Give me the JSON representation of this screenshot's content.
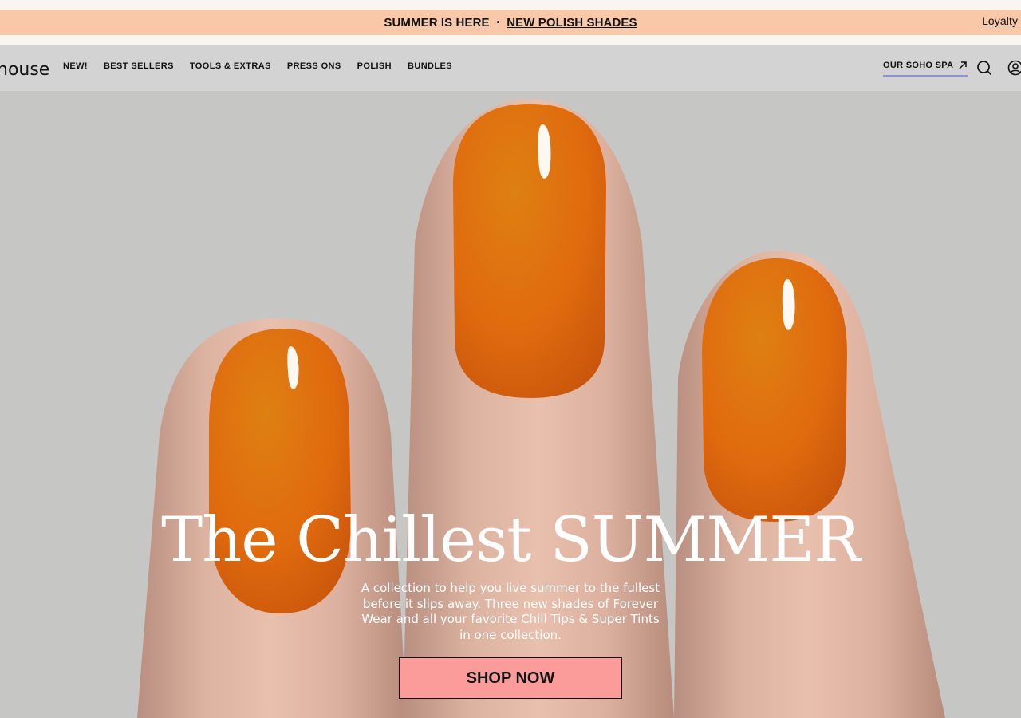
{
  "promo": {
    "text": "SUMMER IS HERE",
    "separator": "•",
    "link": "NEW POLISH SHADES",
    "loyalty": "Loyalty"
  },
  "header": {
    "logo": "nouse",
    "menu": [
      "NEW!",
      "BEST SELLERS",
      "TOOLS & EXTRAS",
      "PRESS ONS",
      "POLISH",
      "BUNDLES"
    ],
    "spa_link": "OUR SOHO SPA",
    "icons": [
      "arrow-up-right-icon",
      "search-icon",
      "account-icon"
    ]
  },
  "hero": {
    "headline": "The Chillest SUMMER",
    "subtext": "A collection to help you live summer to the fullest before it slips away. Three new shades of Forever Wear and all your favorite Chill Tips & Super Tints in one collection.",
    "cta": "SHOP NOW"
  },
  "colors": {
    "promo_bar": "#f8c8a8",
    "nav_bg": "#d2d3d2",
    "hero_bg": "#c6c7c5",
    "nail": "#e26e12",
    "cta_bg": "#fb9c9a",
    "spa_underline": "#8a93d8"
  }
}
